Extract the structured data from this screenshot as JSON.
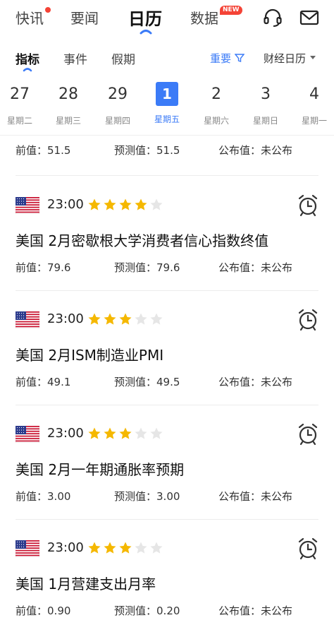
{
  "top_nav": {
    "tabs": [
      {
        "label": "快讯",
        "active": false,
        "dot": true
      },
      {
        "label": "要闻",
        "active": false
      },
      {
        "label": "日历",
        "active": true
      },
      {
        "label": "数据",
        "active": false,
        "badge": "NEW"
      }
    ],
    "icons": [
      "headset-icon",
      "mail-icon"
    ]
  },
  "sub_nav": {
    "tabs": [
      {
        "label": "指标",
        "active": true
      },
      {
        "label": "事件",
        "active": false
      },
      {
        "label": "假期",
        "active": false
      }
    ],
    "filter_label": "重要",
    "calendar_label": "财经日历"
  },
  "dates": [
    {
      "day": "27",
      "weekday": "星期二",
      "selected": false
    },
    {
      "day": "28",
      "weekday": "星期三",
      "selected": false
    },
    {
      "day": "29",
      "weekday": "星期四",
      "selected": false
    },
    {
      "day": "1",
      "weekday": "星期五",
      "selected": true
    },
    {
      "day": "2",
      "weekday": "星期六",
      "selected": false
    },
    {
      "day": "3",
      "weekday": "星期日",
      "selected": false
    },
    {
      "day": "4",
      "weekday": "星期一",
      "selected": false
    }
  ],
  "labels": {
    "previous": "前值：",
    "forecast": "预测值：",
    "published": "公布值："
  },
  "partial_event": {
    "previous": "51.5",
    "forecast": "51.5",
    "published": "未公布"
  },
  "events": [
    {
      "time": "23:00",
      "stars": 4,
      "max_stars": 5,
      "title": "美国 2月密歇根大学消费者信心指数终值",
      "previous": "79.6",
      "forecast": "79.6",
      "published": "未公布"
    },
    {
      "time": "23:00",
      "stars": 3,
      "max_stars": 5,
      "title": "美国 2月ISM制造业PMI",
      "previous": "49.1",
      "forecast": "49.5",
      "published": "未公布"
    },
    {
      "time": "23:00",
      "stars": 3,
      "max_stars": 5,
      "title": "美国 2月一年期通胀率预期",
      "previous": "3.00",
      "forecast": "3.00",
      "published": "未公布"
    },
    {
      "time": "23:00",
      "stars": 3,
      "max_stars": 5,
      "title": "美国 1月营建支出月率",
      "previous": "0.90",
      "forecast": "0.20",
      "published": "未公布"
    }
  ],
  "colors": {
    "accent": "#3b7bf7",
    "star_on": "#f5b800",
    "star_off": "#e6e6e6",
    "badge": "#f44336"
  }
}
